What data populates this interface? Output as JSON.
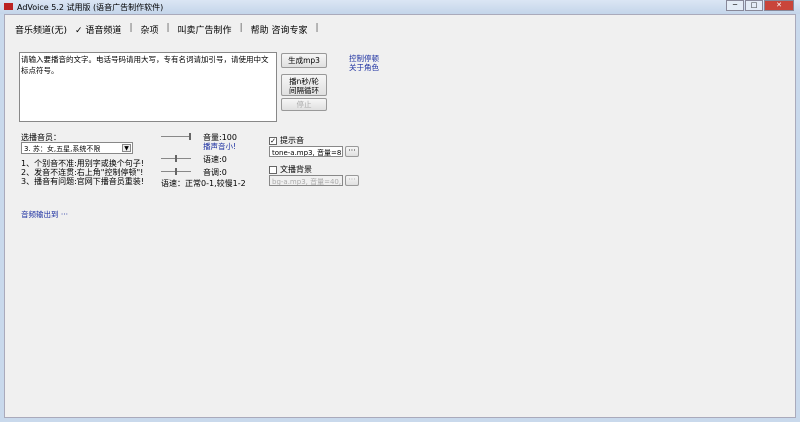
{
  "window": {
    "title": "AdVoice 5.2 试用版 (语音广告制作软件)",
    "min": "─",
    "max": "□",
    "close": "✕"
  },
  "menu": [
    {
      "label": "音乐频道(无)"
    },
    {
      "label": "✓ 语音频道"
    },
    {
      "label": "杂项"
    },
    {
      "label": "叫卖广告制作"
    },
    {
      "label": "帮助 咨询专家"
    }
  ],
  "editor": {
    "text": "请输入要播音的文字。电话号码请用大写，专有名词请加引号，请使用中文标点符号。"
  },
  "buttons": {
    "generate": "生成mp3",
    "loop": "播n秒/轮 间隔循环",
    "stop": "停止"
  },
  "links": {
    "pause": "控制停顿",
    "about_roles": "关于角色",
    "audio_output": "音频输出到 ···"
  },
  "voice": {
    "label": "选播音员：",
    "selected": "3. 苏：女,五星,系统不限"
  },
  "tips": [
    "1、个别音不准:用别字或换个句子!",
    "2、发音不连贯:右上角\"控制停顿\"!",
    "3、播音有问题:官网下播音员重装!"
  ],
  "sliders": {
    "volume": "音量:100",
    "volume_hint": "播声音小!",
    "speed": "语速:0",
    "pitch": "音调:0",
    "speed_note": "语速：正常0-1,较慢1-2",
    "volume_value": 100,
    "speed_value": 0,
    "pitch_value": 0
  },
  "prompt": {
    "label": "提示音",
    "checked": true,
    "value": "tone-a.mp3, 音量=8",
    "browse": "···"
  },
  "background": {
    "label": "文播背景",
    "checked": false,
    "value": "bg-a.mp3, 音量=40,",
    "browse": "···"
  }
}
